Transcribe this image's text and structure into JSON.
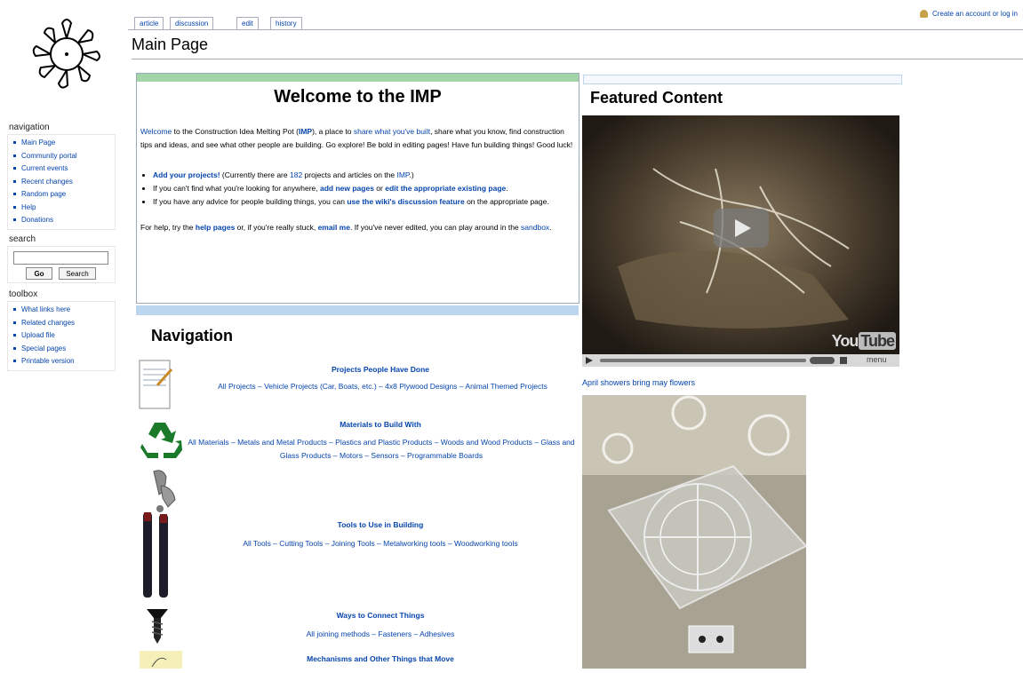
{
  "personal": {
    "create_account": "Create an account or log in"
  },
  "tabs": [
    "article",
    "discussion",
    "edit",
    "history"
  ],
  "page_title": "Main Page",
  "sidebar": {
    "navigation_heading": "navigation",
    "navigation_items": [
      "Main Page",
      "Community portal",
      "Current events",
      "Recent changes",
      "Random page",
      "Help",
      "Donations"
    ],
    "search_heading": "search",
    "search_value": "",
    "go_label": "Go",
    "search_label": "Search",
    "toolbox_heading": "toolbox",
    "toolbox_items": [
      "What links here",
      "Related changes",
      "Upload file",
      "Special pages",
      "Printable version"
    ]
  },
  "welcome": {
    "title": "Welcome to the IMP",
    "intro_link1": "Welcome",
    "intro_t1": " to the Construction Idea Melting Pot (",
    "intro_link2": "IMP",
    "intro_t2": "), a place to ",
    "intro_link3": "share what you've built",
    "intro_t3": ", share what you know, find construction tips and ideas, and see what other people are building. Go explore! Be bold in editing pages! Have fun building things! Good luck!",
    "b1_link": "Add your projects!",
    "b1_t1": " (Currently there are ",
    "b1_count": "182",
    "b1_t2": " projects and articles on the ",
    "b1_link2": "IMP",
    "b1_t3": ".)",
    "b2_t1": "If you can't find what you're looking for anywhere, ",
    "b2_link1": "add new pages",
    "b2_t2": " or ",
    "b2_link2": "edit the appropriate existing page",
    "b2_t3": ".",
    "b3_t1": "If you have any advice for people building things, you can ",
    "b3_link": "use the wiki's discussion feature",
    "b3_t2": " on the appropriate page.",
    "help_t1": "For help, try the ",
    "help_link1": "help pages",
    "help_t2": " or, if you're really stuck, ",
    "help_link2": "email me",
    "help_t3": ". If you've never edited, you can play around in the ",
    "help_link3": "sandbox",
    "help_t4": "."
  },
  "navigation": {
    "heading": "Navigation",
    "sections": [
      {
        "title": "Projects People Have Done",
        "links": "All Projects – Vehicle Projects (Car, Boats, etc.) – 4x8 Plywood Designs – Animal Themed Projects"
      },
      {
        "title": "Materials to Build With",
        "links": "All Materials – Metals and Metal Products – Plastics and Plastic Products – Woods and Wood Products – Glass and Glass Products – Motors – Sensors – Programmable Boards"
      },
      {
        "title": "Tools to Use in Building",
        "links": "All Tools – Cutting Tools – Joining Tools – Metalworking tools – Woodworking tools"
      },
      {
        "title": "Ways to Connect Things",
        "links": "All joining methods – Fasteners – Adhesives"
      },
      {
        "title": "Mechanisms and Other Things that Move",
        "links": ""
      }
    ]
  },
  "featured": {
    "heading": "Featured Content",
    "video_brand_you": "You",
    "video_brand_tube": "Tube",
    "video_menu": "menu",
    "caption": "April showers bring may flowers"
  }
}
